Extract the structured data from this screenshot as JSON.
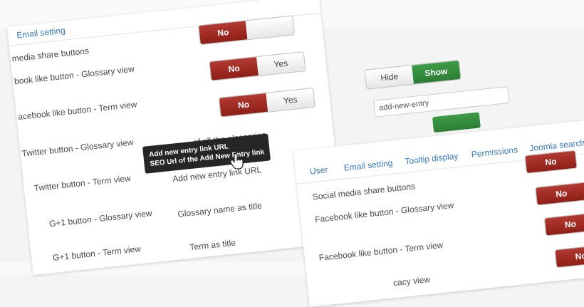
{
  "left_panel": {
    "tab_label": "Email setting",
    "rows": [
      "media share buttons",
      "book like button - Glossary view",
      "acebook like button - Term view",
      "Twitter button - Glossary view",
      "Twitter button - Term view",
      "G+1 button - Glossary view",
      "G+1 button - Term view"
    ]
  },
  "middle_panel": {
    "toggles": [
      {
        "left": "No",
        "right": ""
      },
      {
        "left": "No",
        "right": "Yes"
      },
      {
        "left": "No",
        "right": "Yes"
      }
    ],
    "partial_row": "of all the glossaries",
    "rows": [
      "Add new entry link URL",
      "Glossary name as title",
      "Term as title"
    ],
    "tooltip": {
      "title": "Add new entry link URL",
      "body": "SEO Url of the Add New Entry link"
    }
  },
  "right_top": {
    "toggle": {
      "left": "Hide",
      "right": "Show"
    },
    "slug_value": "add-new-entry"
  },
  "right_panel": {
    "tabs": [
      "User",
      "Email setting",
      "Tooltip display",
      "Permissions",
      "Joomla search"
    ],
    "rows": [
      "Social media share buttons",
      "Facebook like button - Glossary view",
      "Facebook like button - Term view",
      "cacy view"
    ],
    "toggles": [
      "No",
      "No",
      "No",
      "No"
    ]
  },
  "colors": {
    "accent_red": "#9e2a22",
    "accent_green": "#348a3c",
    "link_blue": "#3a78b8"
  }
}
